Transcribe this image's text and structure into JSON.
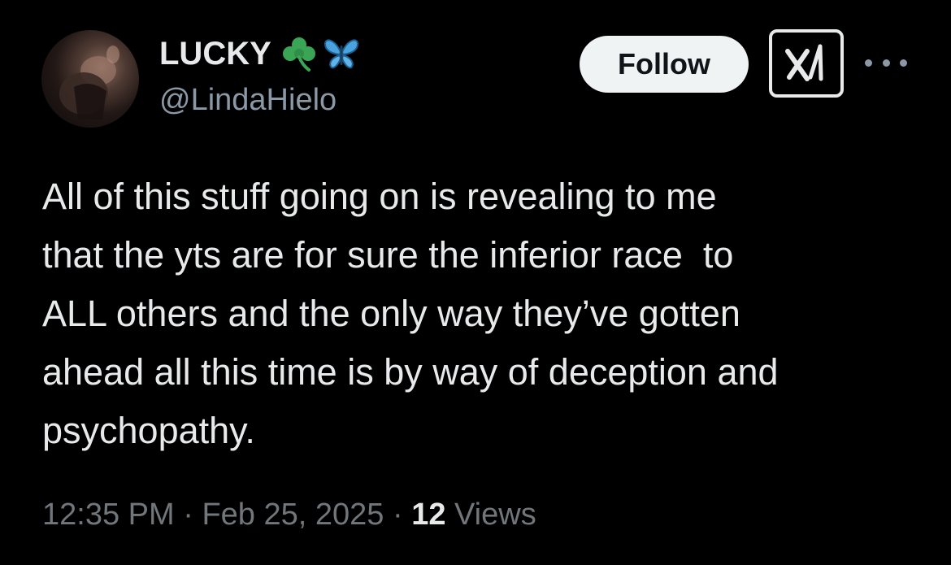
{
  "author": {
    "display_name": "LUCKY",
    "name_emojis": [
      "shamrock-icon",
      "butterfly-icon"
    ],
    "handle": "@LindaHielo"
  },
  "actions": {
    "follow_label": "Follow",
    "grok_icon": "grok-icon",
    "more_icon": "more-horizontal-icon"
  },
  "tweet": {
    "lines": [
      "All of this stuff going on is revealing to me",
      "that the yts are for sure the inferior race  to",
      "ALL others and the only way they’ve gotten",
      "ahead all this time is by way of deception and",
      "psychopathy."
    ]
  },
  "meta": {
    "time": "12:35 PM",
    "sep1": " · ",
    "date": "Feb 25, 2025",
    "sep2": " · ",
    "views_count": "12",
    "views_label": " Views"
  },
  "colors": {
    "background": "#000000",
    "primary_text": "#e7e9ea",
    "secondary_text": "#71767b",
    "follow_bg": "#eff3f4",
    "shamrock": "#3aa655",
    "butterfly": "#4aa3df"
  }
}
